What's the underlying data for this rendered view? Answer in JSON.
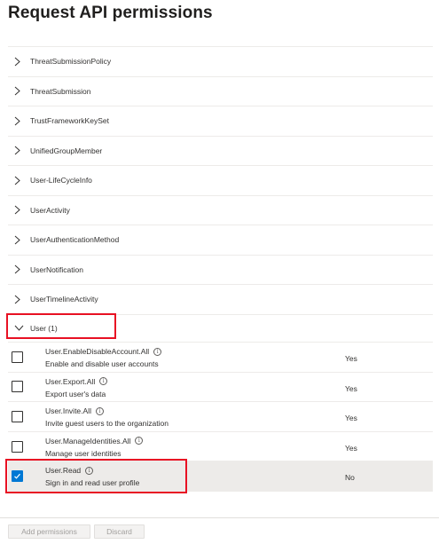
{
  "page": {
    "title": "Request API permissions"
  },
  "groups": [
    {
      "label": "ThreatSubmissionPolicy"
    },
    {
      "label": "ThreatSubmission"
    },
    {
      "label": "TrustFrameworkKeySet"
    },
    {
      "label": "UnifiedGroupMember"
    },
    {
      "label": "User-LifeCycleInfo"
    },
    {
      "label": "UserActivity"
    },
    {
      "label": "UserAuthenticationMethod"
    },
    {
      "label": "UserNotification"
    },
    {
      "label": "UserTimelineActivity"
    }
  ],
  "expanded_group": {
    "label": "User (1)"
  },
  "permissions": [
    {
      "name": "User.EnableDisableAccount.All",
      "description": "Enable and disable user accounts",
      "admin_consent": "Yes",
      "checked": false
    },
    {
      "name": "User.Export.All",
      "description": "Export user's data",
      "admin_consent": "Yes",
      "checked": false
    },
    {
      "name": "User.Invite.All",
      "description": "Invite guest users to the organization",
      "admin_consent": "Yes",
      "checked": false
    },
    {
      "name": "User.ManageIdentities.All",
      "description": "Manage user identities",
      "admin_consent": "Yes",
      "checked": false
    },
    {
      "name": "User.Read",
      "description": "Sign in and read user profile",
      "admin_consent": "No",
      "checked": true
    }
  ],
  "footer": {
    "add_label": "Add permissions",
    "discard_label": "Discard"
  },
  "colors": {
    "accent": "#0078d4",
    "highlight": "#e81123"
  },
  "icons": {
    "info": "i"
  }
}
